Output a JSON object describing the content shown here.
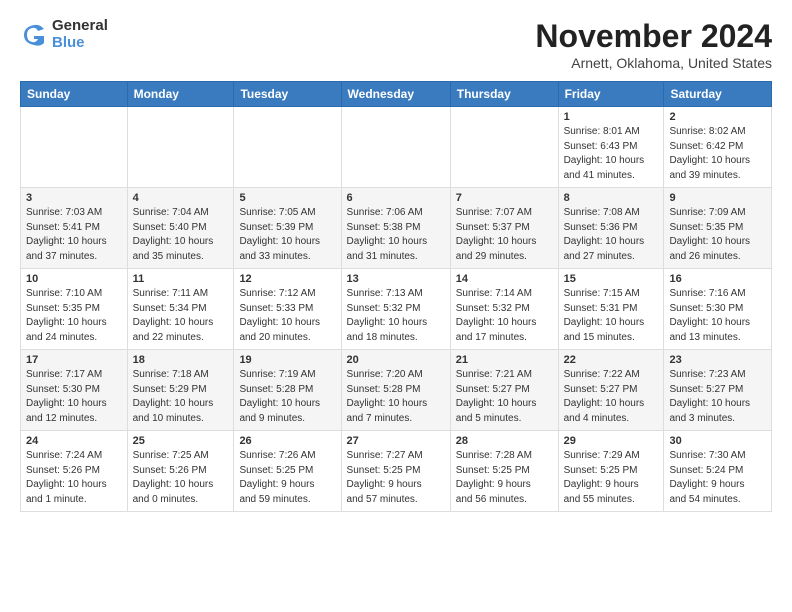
{
  "header": {
    "logo_line1": "General",
    "logo_line2": "Blue",
    "month": "November 2024",
    "location": "Arnett, Oklahoma, United States"
  },
  "weekdays": [
    "Sunday",
    "Monday",
    "Tuesday",
    "Wednesday",
    "Thursday",
    "Friday",
    "Saturday"
  ],
  "weeks": [
    [
      {
        "day": "",
        "info": ""
      },
      {
        "day": "",
        "info": ""
      },
      {
        "day": "",
        "info": ""
      },
      {
        "day": "",
        "info": ""
      },
      {
        "day": "",
        "info": ""
      },
      {
        "day": "1",
        "info": "Sunrise: 8:01 AM\nSunset: 6:43 PM\nDaylight: 10 hours\nand 41 minutes."
      },
      {
        "day": "2",
        "info": "Sunrise: 8:02 AM\nSunset: 6:42 PM\nDaylight: 10 hours\nand 39 minutes."
      }
    ],
    [
      {
        "day": "3",
        "info": "Sunrise: 7:03 AM\nSunset: 5:41 PM\nDaylight: 10 hours\nand 37 minutes."
      },
      {
        "day": "4",
        "info": "Sunrise: 7:04 AM\nSunset: 5:40 PM\nDaylight: 10 hours\nand 35 minutes."
      },
      {
        "day": "5",
        "info": "Sunrise: 7:05 AM\nSunset: 5:39 PM\nDaylight: 10 hours\nand 33 minutes."
      },
      {
        "day": "6",
        "info": "Sunrise: 7:06 AM\nSunset: 5:38 PM\nDaylight: 10 hours\nand 31 minutes."
      },
      {
        "day": "7",
        "info": "Sunrise: 7:07 AM\nSunset: 5:37 PM\nDaylight: 10 hours\nand 29 minutes."
      },
      {
        "day": "8",
        "info": "Sunrise: 7:08 AM\nSunset: 5:36 PM\nDaylight: 10 hours\nand 27 minutes."
      },
      {
        "day": "9",
        "info": "Sunrise: 7:09 AM\nSunset: 5:35 PM\nDaylight: 10 hours\nand 26 minutes."
      }
    ],
    [
      {
        "day": "10",
        "info": "Sunrise: 7:10 AM\nSunset: 5:35 PM\nDaylight: 10 hours\nand 24 minutes."
      },
      {
        "day": "11",
        "info": "Sunrise: 7:11 AM\nSunset: 5:34 PM\nDaylight: 10 hours\nand 22 minutes."
      },
      {
        "day": "12",
        "info": "Sunrise: 7:12 AM\nSunset: 5:33 PM\nDaylight: 10 hours\nand 20 minutes."
      },
      {
        "day": "13",
        "info": "Sunrise: 7:13 AM\nSunset: 5:32 PM\nDaylight: 10 hours\nand 18 minutes."
      },
      {
        "day": "14",
        "info": "Sunrise: 7:14 AM\nSunset: 5:32 PM\nDaylight: 10 hours\nand 17 minutes."
      },
      {
        "day": "15",
        "info": "Sunrise: 7:15 AM\nSunset: 5:31 PM\nDaylight: 10 hours\nand 15 minutes."
      },
      {
        "day": "16",
        "info": "Sunrise: 7:16 AM\nSunset: 5:30 PM\nDaylight: 10 hours\nand 13 minutes."
      }
    ],
    [
      {
        "day": "17",
        "info": "Sunrise: 7:17 AM\nSunset: 5:30 PM\nDaylight: 10 hours\nand 12 minutes."
      },
      {
        "day": "18",
        "info": "Sunrise: 7:18 AM\nSunset: 5:29 PM\nDaylight: 10 hours\nand 10 minutes."
      },
      {
        "day": "19",
        "info": "Sunrise: 7:19 AM\nSunset: 5:28 PM\nDaylight: 10 hours\nand 9 minutes."
      },
      {
        "day": "20",
        "info": "Sunrise: 7:20 AM\nSunset: 5:28 PM\nDaylight: 10 hours\nand 7 minutes."
      },
      {
        "day": "21",
        "info": "Sunrise: 7:21 AM\nSunset: 5:27 PM\nDaylight: 10 hours\nand 5 minutes."
      },
      {
        "day": "22",
        "info": "Sunrise: 7:22 AM\nSunset: 5:27 PM\nDaylight: 10 hours\nand 4 minutes."
      },
      {
        "day": "23",
        "info": "Sunrise: 7:23 AM\nSunset: 5:27 PM\nDaylight: 10 hours\nand 3 minutes."
      }
    ],
    [
      {
        "day": "24",
        "info": "Sunrise: 7:24 AM\nSunset: 5:26 PM\nDaylight: 10 hours\nand 1 minute."
      },
      {
        "day": "25",
        "info": "Sunrise: 7:25 AM\nSunset: 5:26 PM\nDaylight: 10 hours\nand 0 minutes."
      },
      {
        "day": "26",
        "info": "Sunrise: 7:26 AM\nSunset: 5:25 PM\nDaylight: 9 hours\nand 59 minutes."
      },
      {
        "day": "27",
        "info": "Sunrise: 7:27 AM\nSunset: 5:25 PM\nDaylight: 9 hours\nand 57 minutes."
      },
      {
        "day": "28",
        "info": "Sunrise: 7:28 AM\nSunset: 5:25 PM\nDaylight: 9 hours\nand 56 minutes."
      },
      {
        "day": "29",
        "info": "Sunrise: 7:29 AM\nSunset: 5:25 PM\nDaylight: 9 hours\nand 55 minutes."
      },
      {
        "day": "30",
        "info": "Sunrise: 7:30 AM\nSunset: 5:24 PM\nDaylight: 9 hours\nand 54 minutes."
      }
    ]
  ]
}
